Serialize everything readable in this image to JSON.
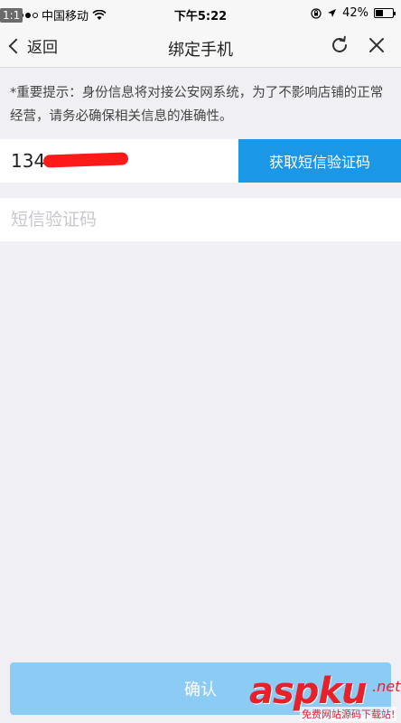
{
  "status_bar": {
    "badge": "1:1",
    "carrier": "中国移动",
    "time": "下午5:22",
    "battery": "42%",
    "battery_level": 0.42
  },
  "nav": {
    "back_label": "返回",
    "title": "绑定手机"
  },
  "notice": "*重要提示：身份信息将对接公安网系统，为了不影响店铺的正常经营，请务必确保相关信息的准确性。",
  "phone": {
    "value": "134"
  },
  "sms_button_label": "获取短信验证码",
  "code_input": {
    "placeholder": "短信验证码",
    "value": ""
  },
  "confirm_label": "确认",
  "watermark": {
    "main": "aspku",
    "suffix": ".net",
    "sub": "免费网站源码下载站!"
  },
  "colors": {
    "accent": "#1a97e6",
    "confirm_disabled": "#8ccbf4",
    "background": "#efeff4"
  },
  "icons": [
    "wifi-icon",
    "lock-icon",
    "location-icon",
    "battery-icon",
    "back-chevron-icon",
    "refresh-icon",
    "close-icon"
  ]
}
